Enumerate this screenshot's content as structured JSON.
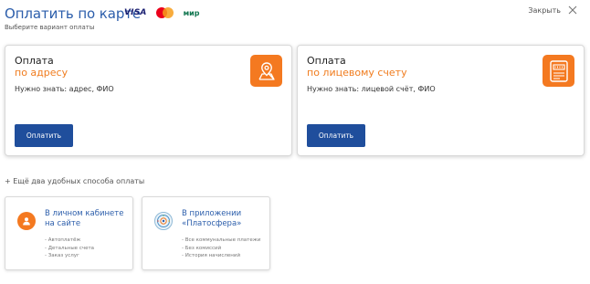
{
  "header": {
    "title": "Оплатить по карте",
    "subtitle": "Выберите вариант оплаты",
    "payment_systems": {
      "visa": "VISA",
      "mir": "мир"
    },
    "close_label": "Закрыть"
  },
  "cards": [
    {
      "title": "Оплата",
      "accent": "по адресу",
      "hint": "Нужно знать: адрес, ФИО",
      "button_label": "Оплатить",
      "icon": "map-pin-icon"
    },
    {
      "title": "Оплата",
      "accent": "по лицевому счету",
      "hint": "Нужно знать: лицевой счёт, ФИО",
      "button_label": "Оплатить",
      "icon": "meter-icon"
    }
  ],
  "more_link": "+ Ещё два удобных способа оплаты",
  "alternatives": [
    {
      "title": "В личном кабинете на сайте",
      "features": [
        "- Автоплатёж",
        "- Детальные счета",
        "- Заказ услуг"
      ],
      "icon": "user-icon"
    },
    {
      "title": "В приложении «Платосфера»",
      "features": [
        "- Все коммунальные платежи",
        "- Без комиссий",
        "- История начислений"
      ],
      "icon": "app-logo-icon"
    }
  ],
  "colors": {
    "brand_blue": "#1f4e9c",
    "title_blue": "#2c5eab",
    "accent_orange": "#f47920"
  }
}
